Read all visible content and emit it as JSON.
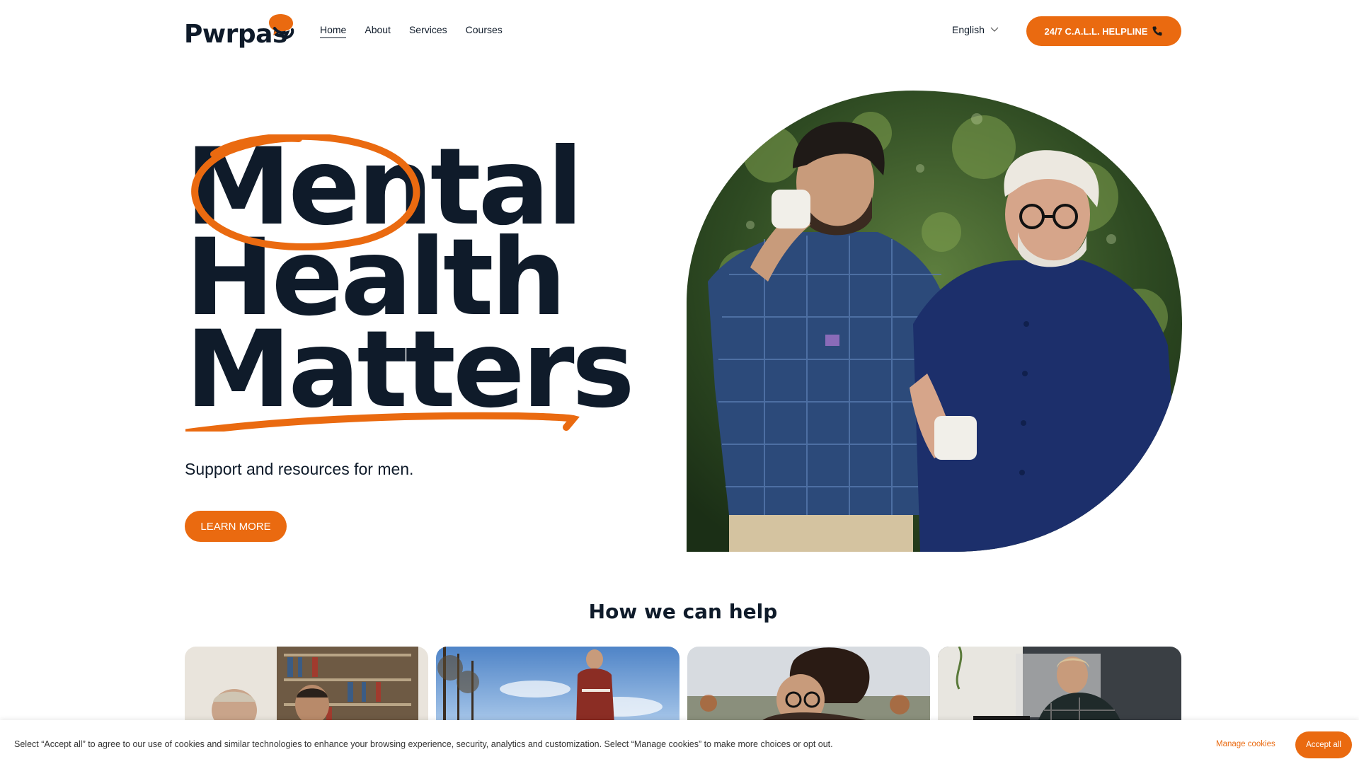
{
  "brand": {
    "name": "Pwrpas",
    "accent": "#ea6a10",
    "text_color": "#0f1b2a"
  },
  "nav": {
    "items": [
      {
        "label": "Home",
        "active": true
      },
      {
        "label": "About",
        "active": false
      },
      {
        "label": "Services",
        "active": false
      },
      {
        "label": "Courses",
        "active": false
      }
    ]
  },
  "header": {
    "language": "English",
    "language_icon": "chevron-down-icon",
    "helpline_label": "24/7 C.A.L.L. HELPLINE",
    "helpline_icon": "phone-icon"
  },
  "hero": {
    "line1": "Mental",
    "line2": "Health",
    "line3": "Matters",
    "subtitle": "Support and resources for men.",
    "cta": "LEARN MORE"
  },
  "help": {
    "title": "How we can help"
  },
  "cookie": {
    "text": "Select “Accept all” to agree to our use of cookies and similar technologies to enhance your browsing experience, security, analytics and customization. Select “Manage cookies” to make more choices or opt out.",
    "manage": "Manage cookies",
    "accept": "Accept all"
  }
}
